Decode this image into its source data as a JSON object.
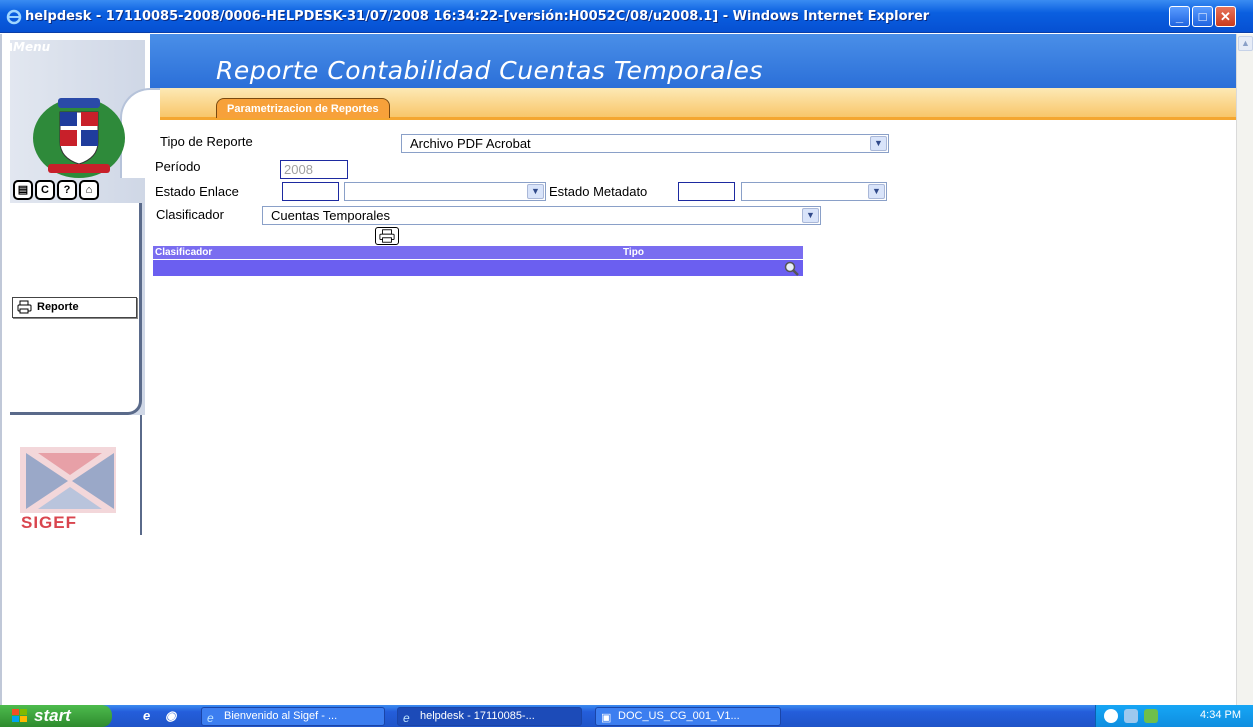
{
  "window": {
    "title": "helpdesk - 17110085-2008/0006-HELPDESK-31/07/2008 16:34:22-[versión:H0052C/08/u2008.1] - Windows Internet Explorer",
    "minimize": "_",
    "maximize": "□",
    "close": "✕"
  },
  "header": {
    "menu_label": "Menu",
    "page_title": "Reporte Contabilidad Cuentas Temporales",
    "tab_label": "Parametrizacion de Reportes"
  },
  "sidebar": {
    "icons": [
      "document-icon",
      "refresh-icon",
      "help-icon",
      "home-icon"
    ],
    "icon_glyphs": [
      "▤",
      "C",
      "?",
      "⌂"
    ],
    "report_button": "Reporte",
    "logo_text": "SIGEF"
  },
  "form": {
    "tipo_reporte_label": "Tipo de Reporte",
    "tipo_reporte_value": "Archivo PDF Acrobat",
    "periodo_label": "Período",
    "periodo_value": "2008",
    "estado_enlace_label": "Estado Enlace",
    "estado_enlace_code": "",
    "estado_enlace_value": "",
    "estado_metadato_label": "Estado Metadato",
    "estado_metadato_code": "",
    "estado_metadato_value": "",
    "clasificador_label": "Clasificador",
    "clasificador_value": "Cuentas Temporales"
  },
  "grid": {
    "columns": [
      "Clasificador",
      "Tipo"
    ]
  },
  "taskbar": {
    "start_label": "start",
    "tasks": [
      "Bienvenido al Sigef - ...",
      "helpdesk - 17110085-...",
      "DOC_US_CG_001_V1..."
    ],
    "clock": "4:34 PM"
  },
  "colors": {
    "header_blue": "#2b6fd8",
    "header_orange": "#f8c66a",
    "grid_purple": "#6b5ff0",
    "field_border": "#1d2aa0"
  }
}
